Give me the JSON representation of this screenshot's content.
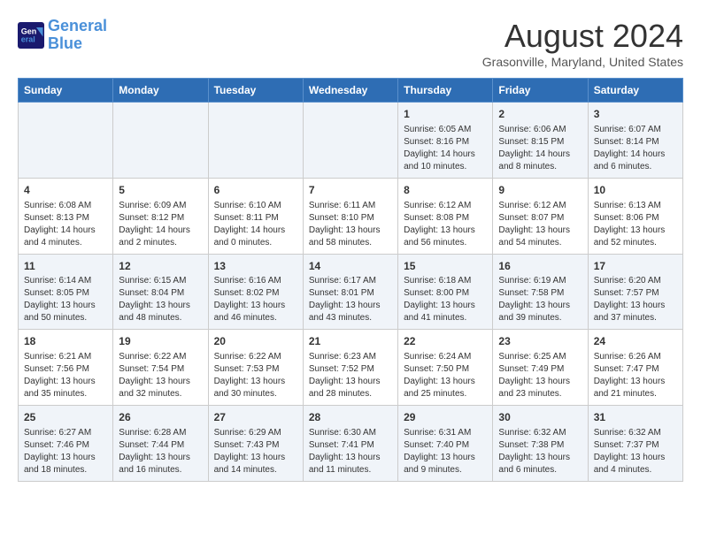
{
  "header": {
    "logo_line1": "General",
    "logo_line2": "Blue",
    "month": "August 2024",
    "location": "Grasonville, Maryland, United States"
  },
  "weekdays": [
    "Sunday",
    "Monday",
    "Tuesday",
    "Wednesday",
    "Thursday",
    "Friday",
    "Saturday"
  ],
  "weeks": [
    [
      {
        "day": "",
        "info": ""
      },
      {
        "day": "",
        "info": ""
      },
      {
        "day": "",
        "info": ""
      },
      {
        "day": "",
        "info": ""
      },
      {
        "day": "1",
        "info": "Sunrise: 6:05 AM\nSunset: 8:16 PM\nDaylight: 14 hours\nand 10 minutes."
      },
      {
        "day": "2",
        "info": "Sunrise: 6:06 AM\nSunset: 8:15 PM\nDaylight: 14 hours\nand 8 minutes."
      },
      {
        "day": "3",
        "info": "Sunrise: 6:07 AM\nSunset: 8:14 PM\nDaylight: 14 hours\nand 6 minutes."
      }
    ],
    [
      {
        "day": "4",
        "info": "Sunrise: 6:08 AM\nSunset: 8:13 PM\nDaylight: 14 hours\nand 4 minutes."
      },
      {
        "day": "5",
        "info": "Sunrise: 6:09 AM\nSunset: 8:12 PM\nDaylight: 14 hours\nand 2 minutes."
      },
      {
        "day": "6",
        "info": "Sunrise: 6:10 AM\nSunset: 8:11 PM\nDaylight: 14 hours\nand 0 minutes."
      },
      {
        "day": "7",
        "info": "Sunrise: 6:11 AM\nSunset: 8:10 PM\nDaylight: 13 hours\nand 58 minutes."
      },
      {
        "day": "8",
        "info": "Sunrise: 6:12 AM\nSunset: 8:08 PM\nDaylight: 13 hours\nand 56 minutes."
      },
      {
        "day": "9",
        "info": "Sunrise: 6:12 AM\nSunset: 8:07 PM\nDaylight: 13 hours\nand 54 minutes."
      },
      {
        "day": "10",
        "info": "Sunrise: 6:13 AM\nSunset: 8:06 PM\nDaylight: 13 hours\nand 52 minutes."
      }
    ],
    [
      {
        "day": "11",
        "info": "Sunrise: 6:14 AM\nSunset: 8:05 PM\nDaylight: 13 hours\nand 50 minutes."
      },
      {
        "day": "12",
        "info": "Sunrise: 6:15 AM\nSunset: 8:04 PM\nDaylight: 13 hours\nand 48 minutes."
      },
      {
        "day": "13",
        "info": "Sunrise: 6:16 AM\nSunset: 8:02 PM\nDaylight: 13 hours\nand 46 minutes."
      },
      {
        "day": "14",
        "info": "Sunrise: 6:17 AM\nSunset: 8:01 PM\nDaylight: 13 hours\nand 43 minutes."
      },
      {
        "day": "15",
        "info": "Sunrise: 6:18 AM\nSunset: 8:00 PM\nDaylight: 13 hours\nand 41 minutes."
      },
      {
        "day": "16",
        "info": "Sunrise: 6:19 AM\nSunset: 7:58 PM\nDaylight: 13 hours\nand 39 minutes."
      },
      {
        "day": "17",
        "info": "Sunrise: 6:20 AM\nSunset: 7:57 PM\nDaylight: 13 hours\nand 37 minutes."
      }
    ],
    [
      {
        "day": "18",
        "info": "Sunrise: 6:21 AM\nSunset: 7:56 PM\nDaylight: 13 hours\nand 35 minutes."
      },
      {
        "day": "19",
        "info": "Sunrise: 6:22 AM\nSunset: 7:54 PM\nDaylight: 13 hours\nand 32 minutes."
      },
      {
        "day": "20",
        "info": "Sunrise: 6:22 AM\nSunset: 7:53 PM\nDaylight: 13 hours\nand 30 minutes."
      },
      {
        "day": "21",
        "info": "Sunrise: 6:23 AM\nSunset: 7:52 PM\nDaylight: 13 hours\nand 28 minutes."
      },
      {
        "day": "22",
        "info": "Sunrise: 6:24 AM\nSunset: 7:50 PM\nDaylight: 13 hours\nand 25 minutes."
      },
      {
        "day": "23",
        "info": "Sunrise: 6:25 AM\nSunset: 7:49 PM\nDaylight: 13 hours\nand 23 minutes."
      },
      {
        "day": "24",
        "info": "Sunrise: 6:26 AM\nSunset: 7:47 PM\nDaylight: 13 hours\nand 21 minutes."
      }
    ],
    [
      {
        "day": "25",
        "info": "Sunrise: 6:27 AM\nSunset: 7:46 PM\nDaylight: 13 hours\nand 18 minutes."
      },
      {
        "day": "26",
        "info": "Sunrise: 6:28 AM\nSunset: 7:44 PM\nDaylight: 13 hours\nand 16 minutes."
      },
      {
        "day": "27",
        "info": "Sunrise: 6:29 AM\nSunset: 7:43 PM\nDaylight: 13 hours\nand 14 minutes."
      },
      {
        "day": "28",
        "info": "Sunrise: 6:30 AM\nSunset: 7:41 PM\nDaylight: 13 hours\nand 11 minutes."
      },
      {
        "day": "29",
        "info": "Sunrise: 6:31 AM\nSunset: 7:40 PM\nDaylight: 13 hours\nand 9 minutes."
      },
      {
        "day": "30",
        "info": "Sunrise: 6:32 AM\nSunset: 7:38 PM\nDaylight: 13 hours\nand 6 minutes."
      },
      {
        "day": "31",
        "info": "Sunrise: 6:32 AM\nSunset: 7:37 PM\nDaylight: 13 hours\nand 4 minutes."
      }
    ]
  ]
}
